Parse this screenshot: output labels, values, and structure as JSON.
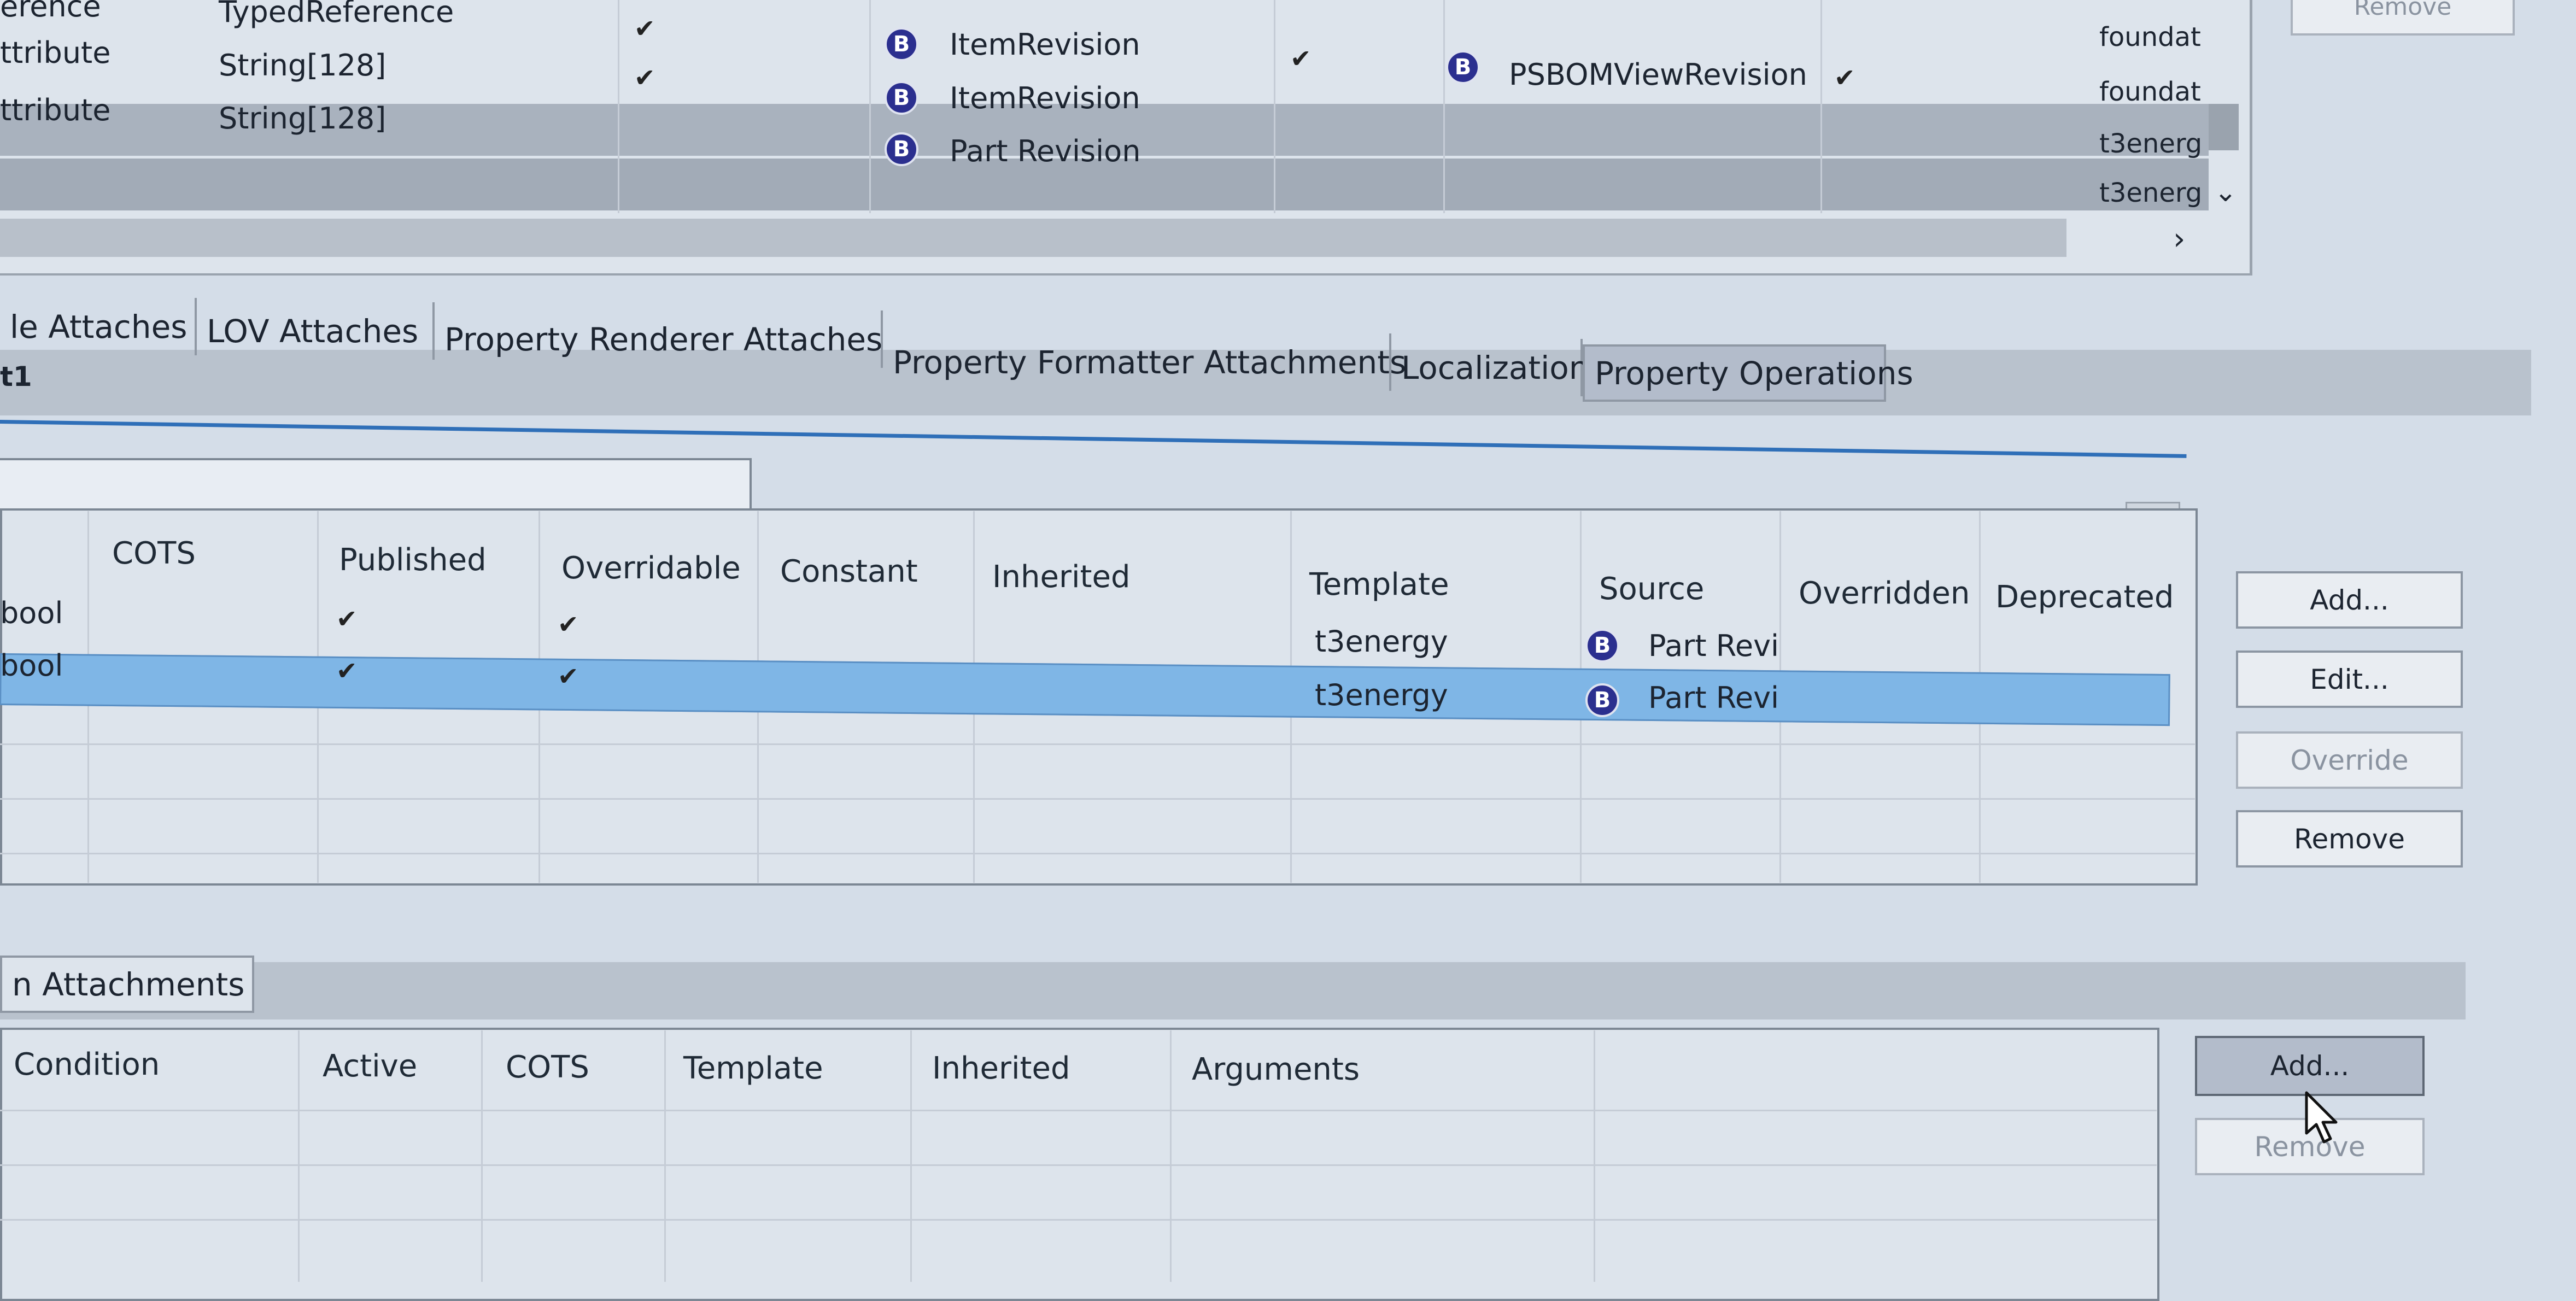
{
  "top_table": {
    "rows": [
      {
        "name": "erence",
        "type": "TypedReference",
        "checked": "✔",
        "source": "",
        "overridable": "",
        "target": "",
        "target_check": "",
        "template": "foundat"
      },
      {
        "name": "ttribute",
        "type": "String[128]",
        "checked": "✔",
        "source": "ItemRevision",
        "overridable": "✔",
        "target": "",
        "target_check": "",
        "template": "foundat"
      },
      {
        "name": "ttribute",
        "type": "String[128]",
        "checked": "✔",
        "source": "ItemRevision",
        "overridable": "",
        "target": "PSBOMViewRevision",
        "target_check": "✔",
        "template": "foundat"
      },
      {
        "name": "ttribute",
        "type": "String[128]",
        "checked": "",
        "source": "Part Revision",
        "overridable": "",
        "target": "",
        "target_check": "",
        "template": "t3energ"
      },
      {
        "name": "",
        "type": "",
        "checked": "",
        "source": "",
        "overridable": "",
        "target": "",
        "target_check": "",
        "template": "t3energ"
      }
    ],
    "remove_label": "Remove",
    "scroll_right": "›",
    "scroll_down": "⌄"
  },
  "tabs": [
    {
      "label": "le Attaches"
    },
    {
      "label": "LOV Attaches"
    },
    {
      "label": "Property Renderer Attaches"
    },
    {
      "label": "Property Formatter Attachments"
    },
    {
      "label": "Localization"
    },
    {
      "label": "Property Operations"
    }
  ],
  "section_label": "t1",
  "filter_input": {
    "value": "",
    "placeholder": ""
  },
  "ops_table": {
    "columns": [
      "COTS",
      "Published",
      "Overridable",
      "Constant",
      "Inherited",
      "Template",
      "Source",
      "Overridden",
      "Deprecated"
    ],
    "rows": [
      {
        "name": "bool",
        "published": "✔",
        "overridable": "✔",
        "template": "t3energy",
        "source": "Part Revi"
      },
      {
        "name": "bool",
        "published": "✔",
        "overridable": "✔",
        "template": "t3energy",
        "source": "Part Revi"
      }
    ],
    "buttons": {
      "add": "Add...",
      "edit": "Edit...",
      "override": "Override",
      "remove": "Remove"
    }
  },
  "conditions": {
    "tab_label": "n Attachments",
    "columns": [
      "Condition",
      "Active",
      "COTS",
      "Template",
      "Inherited",
      "Arguments"
    ],
    "buttons": {
      "add": "Add...",
      "remove": "Remove"
    }
  },
  "colors": {
    "selection": "#7fb6e6",
    "row_gray": "#a9b2be",
    "accent_line": "#2f6fb8"
  }
}
